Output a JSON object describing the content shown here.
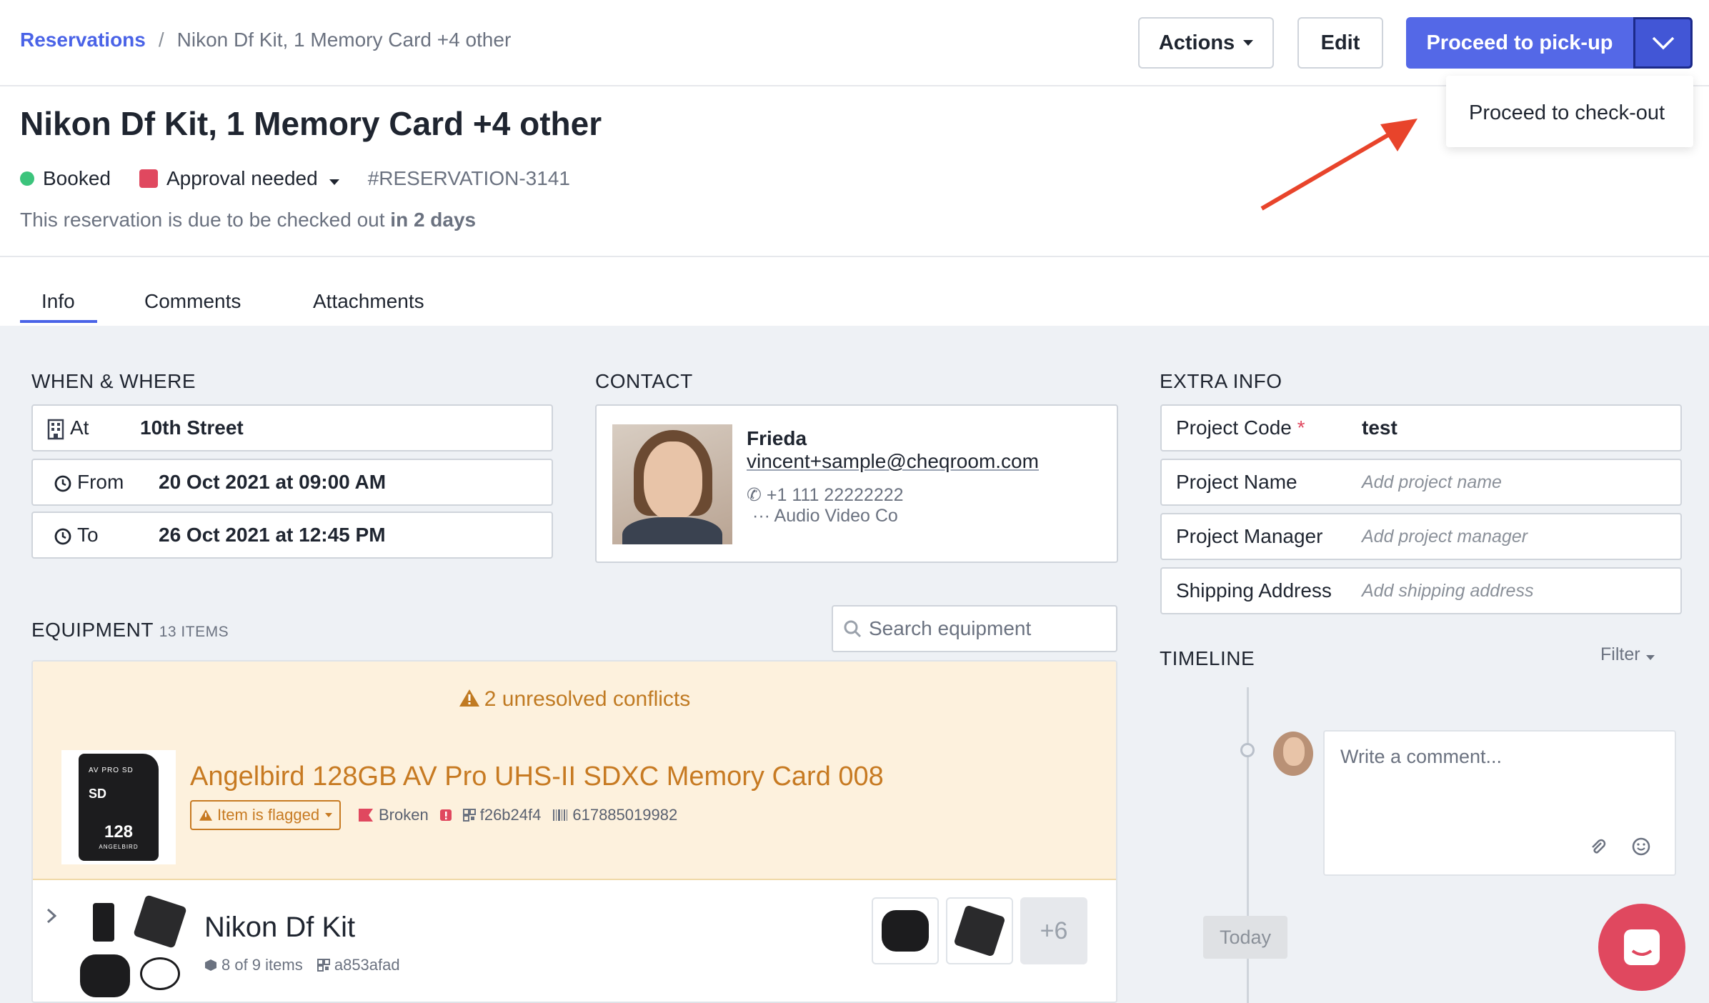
{
  "breadcrumb": {
    "root": "Reservations",
    "separator": "/",
    "current": "Nikon Df Kit, 1 Memory Card +4 other"
  },
  "toolbar": {
    "actions_label": "Actions",
    "edit_label": "Edit",
    "primary_label": "Proceed to pick-up",
    "dropdown_item": "Proceed to check-out"
  },
  "header": {
    "title": "Nikon Df Kit, 1 Memory Card +4 other",
    "status": "Booked",
    "approval": "Approval needed",
    "reference": "#RESERVATION-3141",
    "due_prefix": "This reservation is due to be checked out ",
    "due_emphasis": "in 2 days"
  },
  "tabs": [
    "Info",
    "Comments",
    "Attachments"
  ],
  "when_where": {
    "section_title": "WHEN & WHERE",
    "at_label": "At",
    "at_value": "10th Street",
    "from_label": "From",
    "from_value": "20 Oct 2021 at 09:00 AM",
    "to_label": "To",
    "to_value": "26 Oct 2021 at 12:45 PM"
  },
  "contact": {
    "section_title": "CONTACT",
    "name": "Frieda",
    "email": "vincent+sample@cheqroom.com",
    "phone": "+1 111 22222222",
    "company": "Audio Video Co"
  },
  "extra_info": {
    "section_title": "EXTRA INFO",
    "project_code_label": "Project Code",
    "required_mark": "*",
    "project_code_value": "test",
    "project_name_label": "Project Name",
    "project_name_placeholder": "Add project name",
    "project_manager_label": "Project Manager",
    "project_manager_placeholder": "Add project manager",
    "shipping_label": "Shipping Address",
    "shipping_placeholder": "Add shipping address"
  },
  "equipment": {
    "section_title": "EQUIPMENT",
    "count": "13 ITEMS",
    "search_placeholder": "Search equipment",
    "conflicts": "2 unresolved conflicts",
    "conflict_item": {
      "name": "Angelbird 128GB AV Pro UHS-II SDXC Memory Card 008",
      "flag": "Item is flagged",
      "status": "Broken",
      "code": "f26b24f4",
      "barcode": "617885019982"
    },
    "kit": {
      "name": "Nikon Df Kit",
      "items": "8 of 9 items",
      "code": "a853afad",
      "more": "+6"
    }
  },
  "timeline": {
    "section_title": "TIMELINE",
    "filter_label": "Filter",
    "comment_placeholder": "Write a comment...",
    "today_label": "Today"
  },
  "colors": {
    "accent": "#4a63e7",
    "primary_button": "#5468e7",
    "booked": "#3cc47c",
    "approval": "#e0485f",
    "conflict": "#c77a22",
    "chat": "#e0485f"
  }
}
